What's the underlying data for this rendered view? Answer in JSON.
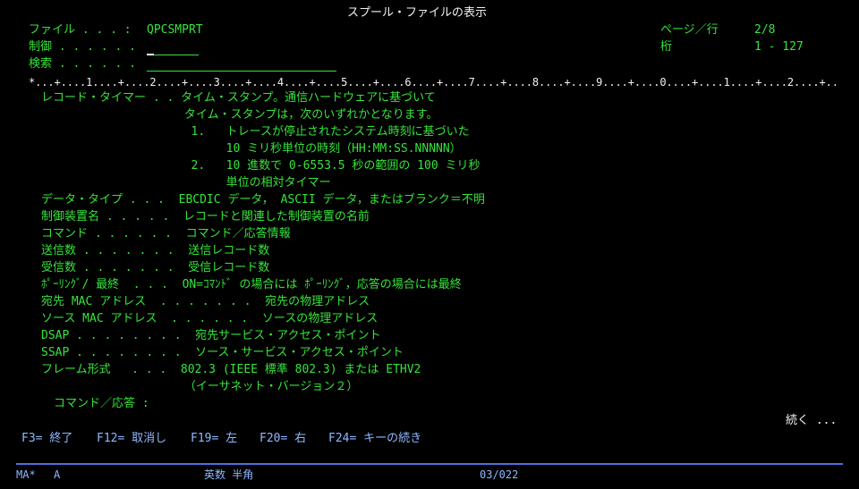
{
  "window": {
    "title": "スプール・ファイルの表示"
  },
  "header": {
    "file_label": "ファイル . . . :",
    "file_value": "QPCSMPRT",
    "control_label": "制御 . . . . . .",
    "control_value": "",
    "search_label": "検索 . . . . . .",
    "search_value": "",
    "page_label": "ページ／行",
    "page_value": "2/8",
    "col_label": "桁",
    "col_value": "1 - 127"
  },
  "ruler": "*...+....1....+....2....+....3....+....4....+....5....+....6....+....7....+....8....+....9....+....0....+....1....+....2....+..",
  "content": {
    "lines": [
      "レコード・タイマー . . タイム・スタンプ。通信ハードウェアに基づいて",
      "                        タイム・スタンプは，次のいずれかとなります。",
      "                          1.   トレースが停止されたシステム時刻に基づいた",
      "                               10 ミリ秒単位の時刻（HH:MM:SS.NNNNN）",
      "                          2.   10 進数で 0-6553.5 秒の範囲の 100 ミリ秒",
      "                               単位の相対タイマー",
      "データ・タイプ . . .  EBCDIC データ， ASCII データ，またはブランク＝不明",
      "制御装置名 . . . . .  レコードと関連した制御装置の名前",
      "コマンド . . . . . .  コマンド／応答情報",
      "送信数 . . . . . . .  送信レコード数",
      "受信数 . . . . . . .  受信レコード数",
      "ﾎﾟｰﾘﾝｸﾞ/ 最終  . . .  ON=ｺﾏﾝﾄﾞ の場合には ﾎﾟｰﾘﾝｸﾞ，応答の場合には最終",
      "宛先 MAC アドレス  . . . . . . .  宛先の物理アドレス",
      "ソース MAC アドレス  . . . . . .  ソースの物理アドレス",
      "DSAP . . . . . . . .  宛先サービス・アクセス・ポイント",
      "SSAP . . . . . . . .  ソース・サービス・アクセス・ポイント",
      "フレーム形式   . . .  802.3 (IEEE 標準 802.3) または ETHV2",
      "                        （イーサネット・バージョン２）"
    ]
  },
  "command": {
    "label": "コマンド／応答 :",
    "value": ""
  },
  "more": "続く ...",
  "function_keys": [
    {
      "key": "F3=",
      "label": "終了"
    },
    {
      "key": "F12=",
      "label": "取消し"
    },
    {
      "key": "F19=",
      "label": "左"
    },
    {
      "key": "F20=",
      "label": "右"
    },
    {
      "key": "F24=",
      "label": "キーの続き"
    }
  ],
  "status_bar": {
    "session": "MA*",
    "mode": "A",
    "input_mode": "英数 半角",
    "cursor_pos": "03/022"
  }
}
